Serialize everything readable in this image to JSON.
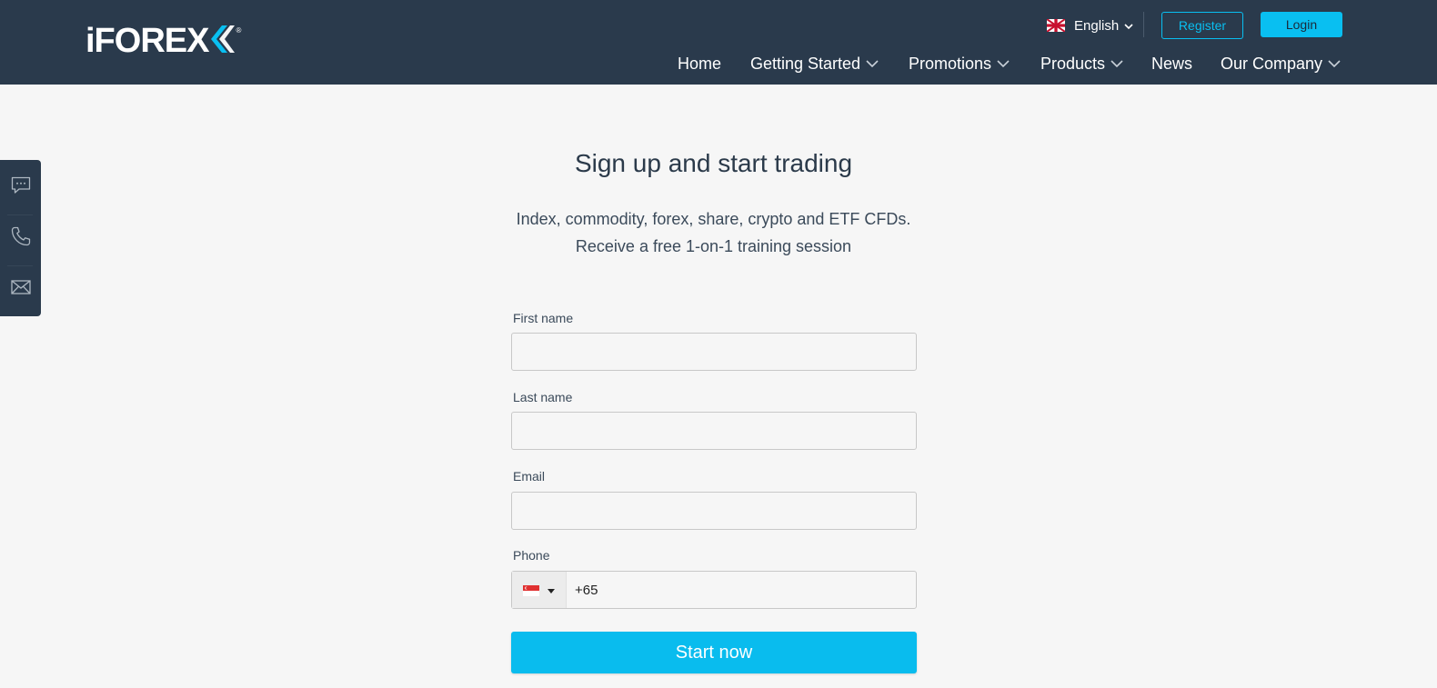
{
  "header": {
    "logo_text": "iFOREX",
    "logo_reg": "®",
    "language": "English",
    "register_label": "Register",
    "login_label": "Login",
    "nav": [
      {
        "label": "Home",
        "has_dropdown": false
      },
      {
        "label": "Getting Started",
        "has_dropdown": true
      },
      {
        "label": "Promotions",
        "has_dropdown": true
      },
      {
        "label": "Products",
        "has_dropdown": true
      },
      {
        "label": "News",
        "has_dropdown": false
      },
      {
        "label": "Our Company",
        "has_dropdown": true
      }
    ]
  },
  "sidebar": {
    "items": [
      {
        "icon": "chat-icon"
      },
      {
        "icon": "phone-icon"
      },
      {
        "icon": "mail-icon"
      }
    ]
  },
  "main": {
    "title": "Sign up and start trading",
    "subtitle_line1": "Index, commodity, forex, share, crypto and ETF CFDs.",
    "subtitle_line2": "Receive a free 1-on-1 training session"
  },
  "form": {
    "first_name_label": "First name",
    "first_name_value": "",
    "last_name_label": "Last name",
    "last_name_value": "",
    "email_label": "Email",
    "email_value": "",
    "phone_label": "Phone",
    "phone_value": "+65",
    "country_flag": "singapore-flag",
    "submit_label": "Start now"
  },
  "colors": {
    "header_bg": "#2a3a4c",
    "accent": "#09bff1",
    "page_bg": "#f6f6f6"
  }
}
